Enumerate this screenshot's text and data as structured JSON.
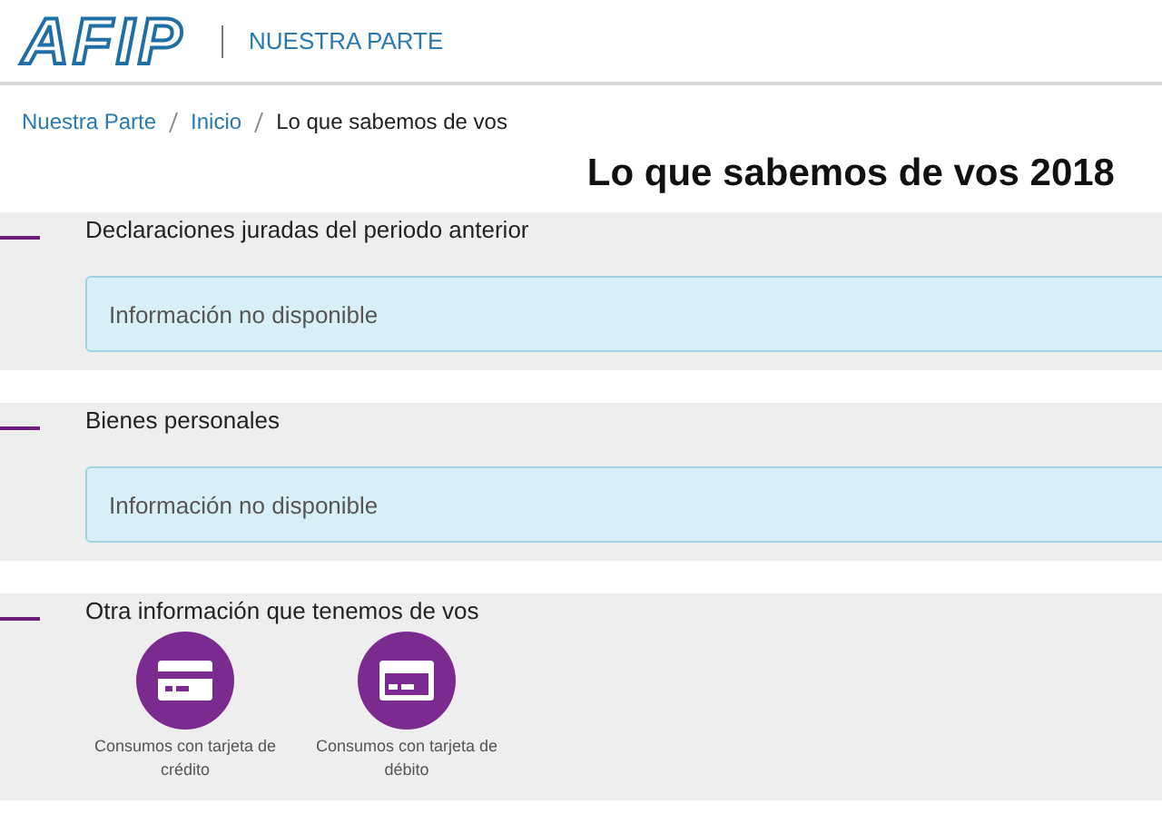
{
  "header": {
    "logo": "AFIP",
    "site_name": "NUESTRA PARTE"
  },
  "breadcrumb": [
    {
      "label": "Nuestra Parte",
      "kind": "link"
    },
    {
      "label": "Inicio",
      "kind": "link"
    },
    {
      "label": "Lo que sabemos de vos",
      "kind": "current"
    }
  ],
  "page_title": "Lo que sabemos de vos 2018",
  "sections": [
    {
      "title": "Declaraciones juradas del periodo anterior",
      "kind": "alert",
      "message": "Información no disponible"
    },
    {
      "title": "Bienes personales",
      "kind": "alert",
      "message": "Información no disponible"
    },
    {
      "title": "Otra información que tenemos de vos",
      "kind": "cards",
      "cards": [
        {
          "label": "Consumos con tarjeta de crédito",
          "kind": "credit"
        },
        {
          "label": "Consumos con tarjeta de débito",
          "kind": "debit"
        }
      ]
    }
  ]
}
